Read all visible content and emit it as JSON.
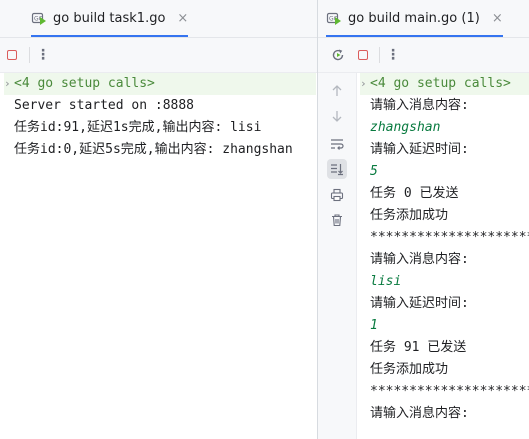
{
  "left": {
    "tab": {
      "label": "go build task1.go",
      "close": "×"
    },
    "toolbar": {
      "more": "⋮"
    },
    "console": [
      {
        "text": "<4 go setup calls>",
        "kind": "fold"
      },
      {
        "text": "Server started on :8888",
        "kind": "out"
      },
      {
        "text": "任务id:91,延迟1s完成,输出内容: lisi",
        "kind": "out"
      },
      {
        "text": "任务id:0,延迟5s完成,输出内容: zhangshan",
        "kind": "out"
      }
    ]
  },
  "right": {
    "tab": {
      "label": "go build main.go (1)",
      "close": "×"
    },
    "toolbar": {
      "more": "⋮"
    },
    "console": [
      {
        "text": "<4 go setup calls>",
        "kind": "fold"
      },
      {
        "text": "请输入消息内容:",
        "kind": "out"
      },
      {
        "text": "zhangshan",
        "kind": "input"
      },
      {
        "text": "请输入延迟时间:",
        "kind": "out"
      },
      {
        "text": "5",
        "kind": "input"
      },
      {
        "text": "任务 0 已发送",
        "kind": "out"
      },
      {
        "text": "任务添加成功",
        "kind": "out"
      },
      {
        "text": "******************************",
        "kind": "out"
      },
      {
        "text": "请输入消息内容:",
        "kind": "out"
      },
      {
        "text": "lisi",
        "kind": "input"
      },
      {
        "text": "请输入延迟时间:",
        "kind": "out"
      },
      {
        "text": "1",
        "kind": "input"
      },
      {
        "text": "任务 91 已发送",
        "kind": "out"
      },
      {
        "text": "任务添加成功",
        "kind": "out"
      },
      {
        "text": "******************************",
        "kind": "out"
      },
      {
        "text": "请输入消息内容:",
        "kind": "out"
      }
    ]
  },
  "icons": {
    "run_config": "go-run-config-icon",
    "stop": "stop-icon",
    "rerun": "rerun-icon",
    "more": "more-options-icon",
    "up": "arrow-up-icon",
    "down": "arrow-down-icon",
    "soft_wrap": "soft-wrap-icon",
    "scroll_end": "scroll-to-end-icon",
    "print": "print-icon",
    "clear": "trash-icon"
  },
  "colors": {
    "accent": "#3574f0",
    "stop": "#db5c5c",
    "user_input": "#087a3f",
    "fold_bg": "#eff8ec"
  }
}
